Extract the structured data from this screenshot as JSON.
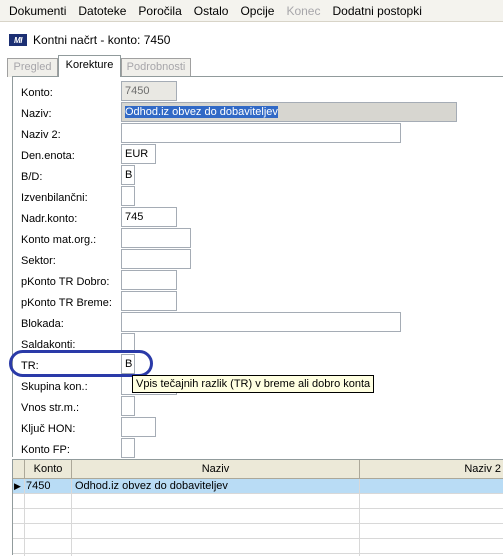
{
  "menu": [
    "Dokumenti",
    "Datoteke",
    "Poročila",
    "Ostalo",
    "Opcije",
    "Konec",
    "Dodatni postopki"
  ],
  "window": {
    "logo": "MI",
    "title": "Kontni načrt - konto: 7450"
  },
  "tabs": [
    "Pregled",
    "Korekture",
    "Podrobnosti"
  ],
  "form": {
    "labels": {
      "konto": "Konto:",
      "naziv": "Naziv:",
      "naziv2": "Naziv 2:",
      "den_enota": "Den.enota:",
      "bd": "B/D:",
      "izvenbilancni": "Izvenbilančni:",
      "nadr_konto": "Nadr.konto:",
      "konto_mat_org": "Konto mat.org.:",
      "sektor": "Sektor:",
      "pkonto_dobro": "pKonto TR Dobro:",
      "pkonto_breme": "pKonto TR Breme:",
      "blokada": "Blokada:",
      "saldakonti": "Saldakonti:",
      "tr": "TR:",
      "skupina_kon": "Skupina kon.:",
      "vnos_str_m": "Vnos str.m.:",
      "kljuc_hon": "Ključ HON:",
      "konto_fp": "Konto FP:"
    },
    "values": {
      "konto": "7450",
      "naziv": "Odhod.iz obvez do dobaviteljev",
      "naziv2": "",
      "den_enota": "EUR",
      "bd": "B",
      "izvenbilancni": "",
      "nadr_konto": "745",
      "konto_mat_org": "",
      "sektor": "",
      "pkonto_dobro": "",
      "pkonto_breme": "",
      "blokada": "",
      "saldakonti": "",
      "tr": "B",
      "skupina_kon": "",
      "vnos_str_m": "",
      "kljuc_hon": "",
      "konto_fp": ""
    }
  },
  "tooltip": "Vpis tečajnih razlik (TR)  v breme ali dobro konta",
  "grid": {
    "columns": [
      "Konto",
      "Naziv",
      "Naziv 2"
    ],
    "rows": [
      {
        "konto": "7450",
        "naziv": "Odhod.iz obvez do dobaviteljev",
        "naziv2": ""
      }
    ]
  },
  "colors": {
    "highlight_oval": "#2a3aa8",
    "selection": "#3169c6",
    "tooltip_bg": "#ffffe1",
    "row_selected": "#b9dcf5"
  }
}
